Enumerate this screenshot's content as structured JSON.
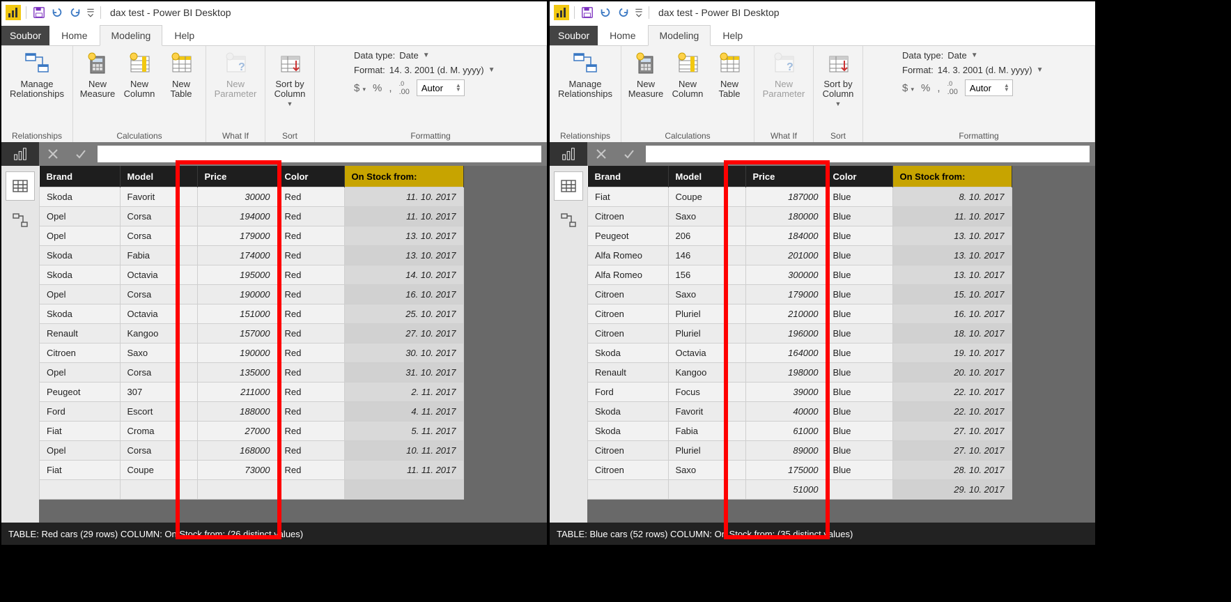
{
  "title": "dax test - Power BI Desktop",
  "tabs": {
    "file": "Soubor",
    "home": "Home",
    "modeling": "Modeling",
    "help": "Help"
  },
  "ribbon": {
    "relationships": {
      "manage": "Manage\nRelationships",
      "cap": "Relationships"
    },
    "calc": {
      "measure": "New\nMeasure",
      "column": "New\nColumn",
      "table": "New\nTable",
      "cap": "Calculations"
    },
    "whatif": {
      "param": "New\nParameter",
      "cap": "What If"
    },
    "sort": {
      "sortby": "Sort by\nColumn",
      "cap": "Sort"
    },
    "fmt": {
      "datatype_lbl": "Data type:",
      "datatype_val": "Date",
      "format_lbl": "Format:",
      "format_val": "14. 3. 2001 (d. M. yyyy)",
      "dollar": "$",
      "pct": "%",
      "comma": ",",
      "dec00": ".00",
      "auto": "Autor",
      "cap": "Formatting"
    }
  },
  "table": {
    "headers": {
      "brand": "Brand",
      "model": "Model",
      "price": "Price",
      "color": "Color",
      "date": "On Stock from:"
    }
  },
  "left": {
    "status": "TABLE: Red cars (29 rows) COLUMN: On Stock from: (26 distinct values)",
    "rows": [
      {
        "brand": "Skoda",
        "model": "Favorit",
        "price": "30000",
        "color": "Red",
        "date": "11. 10. 2017"
      },
      {
        "brand": "Opel",
        "model": "Corsa",
        "price": "194000",
        "color": "Red",
        "date": "11. 10. 2017"
      },
      {
        "brand": "Opel",
        "model": "Corsa",
        "price": "179000",
        "color": "Red",
        "date": "13. 10. 2017"
      },
      {
        "brand": "Skoda",
        "model": "Fabia",
        "price": "174000",
        "color": "Red",
        "date": "13. 10. 2017"
      },
      {
        "brand": "Skoda",
        "model": "Octavia",
        "price": "195000",
        "color": "Red",
        "date": "14. 10. 2017"
      },
      {
        "brand": "Opel",
        "model": "Corsa",
        "price": "190000",
        "color": "Red",
        "date": "16. 10. 2017"
      },
      {
        "brand": "Skoda",
        "model": "Octavia",
        "price": "151000",
        "color": "Red",
        "date": "25. 10. 2017"
      },
      {
        "brand": "Renault",
        "model": "Kangoo",
        "price": "157000",
        "color": "Red",
        "date": "27. 10. 2017"
      },
      {
        "brand": "Citroen",
        "model": "Saxo",
        "price": "190000",
        "color": "Red",
        "date": "30. 10. 2017"
      },
      {
        "brand": "Opel",
        "model": "Corsa",
        "price": "135000",
        "color": "Red",
        "date": "31. 10. 2017"
      },
      {
        "brand": "Peugeot",
        "model": "307",
        "price": "211000",
        "color": "Red",
        "date": "2. 11. 2017"
      },
      {
        "brand": "Ford",
        "model": "Escort",
        "price": "188000",
        "color": "Red",
        "date": "4. 11. 2017"
      },
      {
        "brand": "Fiat",
        "model": "Croma",
        "price": "27000",
        "color": "Red",
        "date": "5. 11. 2017"
      },
      {
        "brand": "Opel",
        "model": "Corsa",
        "price": "168000",
        "color": "Red",
        "date": "10. 11. 2017"
      },
      {
        "brand": "Fiat",
        "model": "Coupe",
        "price": "73000",
        "color": "Red",
        "date": "11. 11. 2017"
      },
      {
        "brand": "",
        "model": "",
        "price": "",
        "color": "",
        "date": ""
      }
    ]
  },
  "right": {
    "status": "TABLE: Blue cars (52 rows) COLUMN: On Stock from: (35 distinct values)",
    "rows": [
      {
        "brand": "Fiat",
        "model": "Coupe",
        "price": "187000",
        "color": "Blue",
        "date": "8. 10. 2017"
      },
      {
        "brand": "Citroen",
        "model": "Saxo",
        "price": "180000",
        "color": "Blue",
        "date": "11. 10. 2017"
      },
      {
        "brand": "Peugeot",
        "model": "206",
        "price": "184000",
        "color": "Blue",
        "date": "13. 10. 2017"
      },
      {
        "brand": "Alfa Romeo",
        "model": "146",
        "price": "201000",
        "color": "Blue",
        "date": "13. 10. 2017"
      },
      {
        "brand": "Alfa Romeo",
        "model": "156",
        "price": "300000",
        "color": "Blue",
        "date": "13. 10. 2017"
      },
      {
        "brand": "Citroen",
        "model": "Saxo",
        "price": "179000",
        "color": "Blue",
        "date": "15. 10. 2017"
      },
      {
        "brand": "Citroen",
        "model": "Pluriel",
        "price": "210000",
        "color": "Blue",
        "date": "16. 10. 2017"
      },
      {
        "brand": "Citroen",
        "model": "Pluriel",
        "price": "196000",
        "color": "Blue",
        "date": "18. 10. 2017"
      },
      {
        "brand": "Skoda",
        "model": "Octavia",
        "price": "164000",
        "color": "Blue",
        "date": "19. 10. 2017"
      },
      {
        "brand": "Renault",
        "model": "Kangoo",
        "price": "198000",
        "color": "Blue",
        "date": "20. 10. 2017"
      },
      {
        "brand": "Ford",
        "model": "Focus",
        "price": "39000",
        "color": "Blue",
        "date": "22. 10. 2017"
      },
      {
        "brand": "Skoda",
        "model": "Favorit",
        "price": "40000",
        "color": "Blue",
        "date": "22. 10. 2017"
      },
      {
        "brand": "Skoda",
        "model": "Fabia",
        "price": "61000",
        "color": "Blue",
        "date": "27. 10. 2017"
      },
      {
        "brand": "Citroen",
        "model": "Pluriel",
        "price": "89000",
        "color": "Blue",
        "date": "27. 10. 2017"
      },
      {
        "brand": "Citroen",
        "model": "Saxo",
        "price": "175000",
        "color": "Blue",
        "date": "28. 10. 2017"
      },
      {
        "brand": "",
        "model": "",
        "price": "51000",
        "color": "",
        "date": "29. 10. 2017"
      }
    ]
  }
}
